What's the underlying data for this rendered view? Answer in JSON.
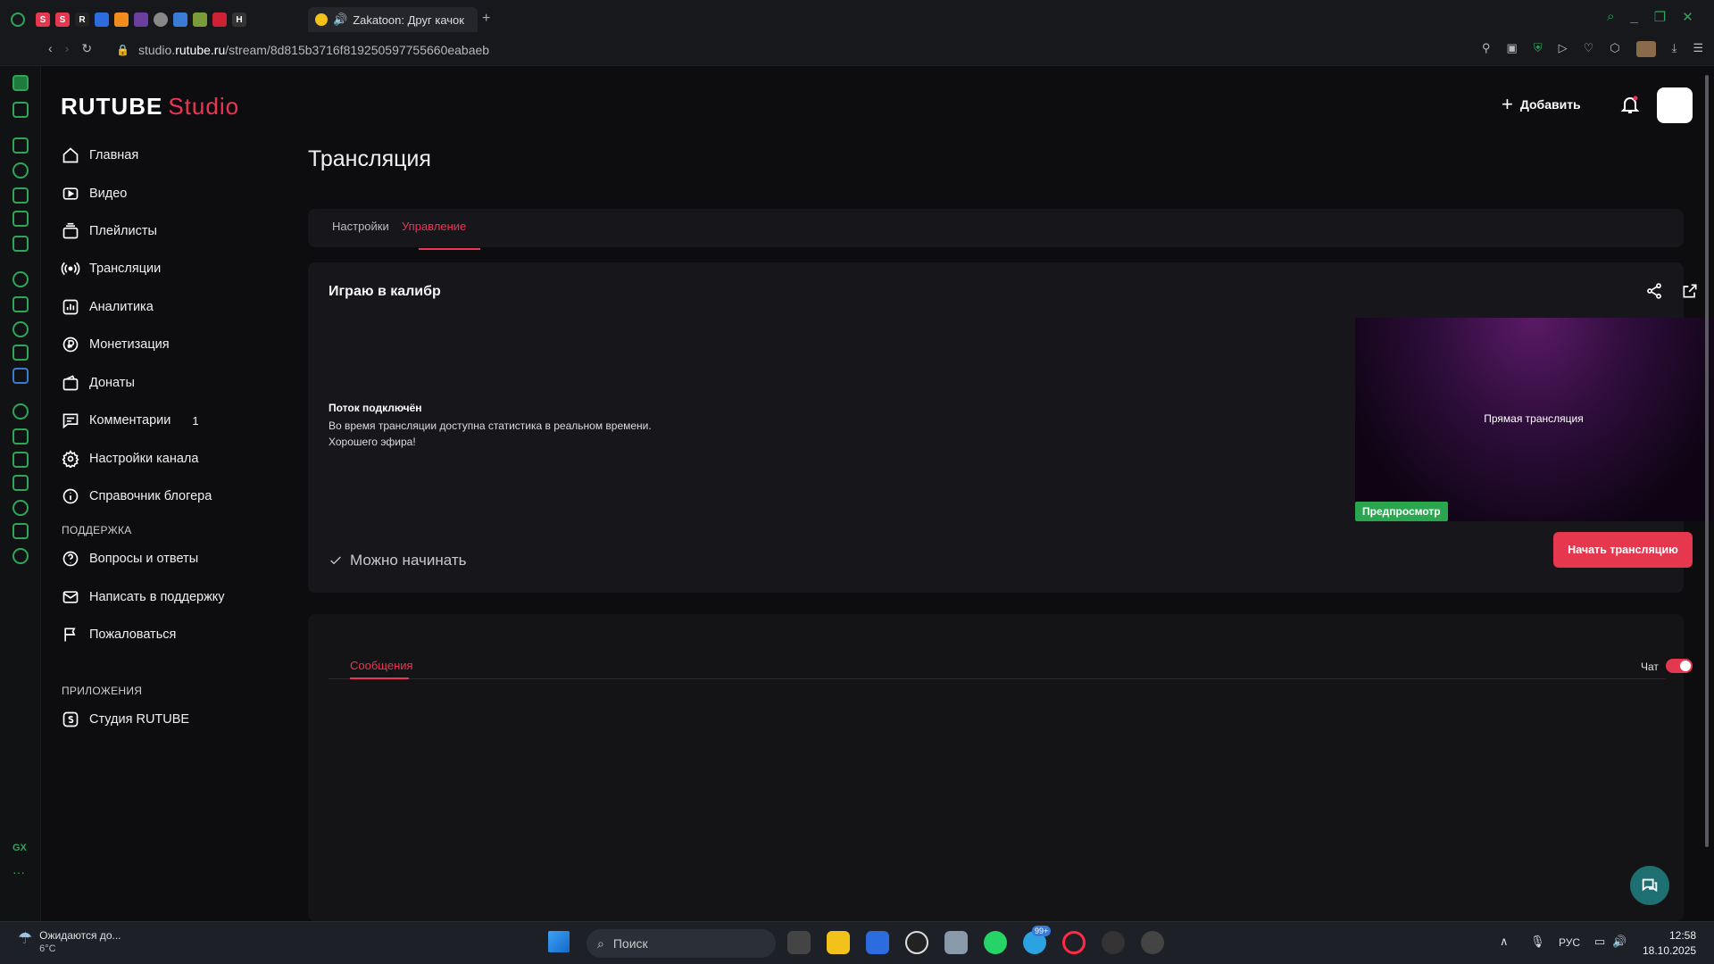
{
  "browser": {
    "active_tab_title": "Zakatoon: Друг качок",
    "url_prefix": "studio.",
    "url_host": "rutube.ru",
    "url_path": "/stream/8d815b3716f819250597755660eabaeb"
  },
  "app": {
    "logo_main": "RUTUBE",
    "logo_sub": "Studio",
    "add_label": "Добавить"
  },
  "sidebar": {
    "items": [
      {
        "label": "Главная",
        "icon": "home-icon"
      },
      {
        "label": "Видео",
        "icon": "video-icon"
      },
      {
        "label": "Плейлисты",
        "icon": "playlist-icon"
      },
      {
        "label": "Трансляции",
        "icon": "broadcast-icon"
      },
      {
        "label": "Аналитика",
        "icon": "analytics-icon"
      },
      {
        "label": "Монетизация",
        "icon": "ruble-icon"
      },
      {
        "label": "Донаты",
        "icon": "wallet-icon"
      },
      {
        "label": "Комментарии",
        "icon": "comment-icon",
        "badge": "1"
      },
      {
        "label": "Настройки канала",
        "icon": "gear-icon"
      },
      {
        "label": "Справочник блогера",
        "icon": "info-icon"
      }
    ],
    "support_heading": "ПОДДЕРЖКА",
    "support_items": [
      {
        "label": "Вопросы и ответы",
        "icon": "question-icon"
      },
      {
        "label": "Написать в поддержку",
        "icon": "mail-icon"
      },
      {
        "label": "Пожаловаться",
        "icon": "flag-icon"
      }
    ],
    "apps_heading": "ПРИЛОЖЕНИЯ",
    "apps_items": [
      {
        "label": "Студия RUTUBE",
        "icon": "studio-icon"
      }
    ]
  },
  "main": {
    "title": "Трансляция",
    "tabs": [
      {
        "label": "Настройки",
        "active": false
      },
      {
        "label": "Управление",
        "active": true
      }
    ],
    "stream": {
      "title": "Играю в калибр",
      "status_title": "Поток подключён",
      "status_line1": "Во время трансляции доступна статистика в реальном времени.",
      "status_line2": "Хорошего эфира!",
      "preview_text": "Прямая трансляция",
      "preview_badge": "Предпросмотр",
      "ready_text": "Можно начинать",
      "start_button": "Начать трансляцию"
    },
    "chat": {
      "tab": "Сообщения",
      "toggle_label": "Чат",
      "toggle_on": true
    }
  },
  "taskbar": {
    "weather_text": "Ожидаются до...",
    "weather_temp": "6°C",
    "search_placeholder": "Поиск",
    "language": "РУС",
    "time": "12:58",
    "date": "18.10.2025",
    "badge_count": "99+"
  },
  "colors": {
    "accent": "#ee3354",
    "preview_badge": "#2aa64f",
    "background": "#0d0d10",
    "card": "#17171b"
  }
}
